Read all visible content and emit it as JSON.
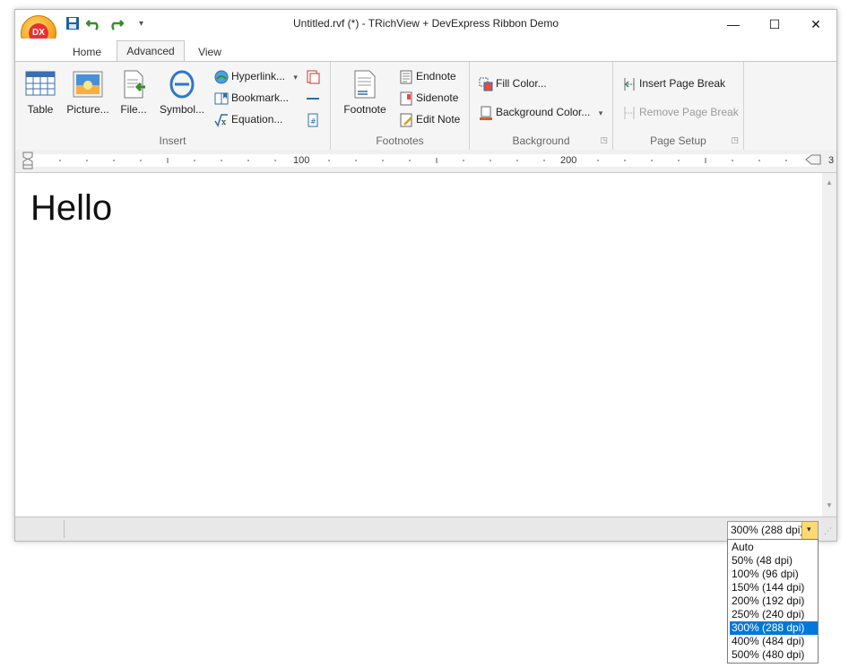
{
  "window": {
    "title": "Untitled.rvf (*) - TRichView + DevExpress Ribbon Demo"
  },
  "app_button": {
    "label": "DX"
  },
  "quick_access": [
    {
      "name": "save-icon"
    },
    {
      "name": "undo-icon"
    },
    {
      "name": "redo-icon"
    },
    {
      "name": "customize-qat-icon"
    }
  ],
  "tabs": [
    {
      "label": "Home"
    },
    {
      "label": "Advanced",
      "active": true
    },
    {
      "label": "View"
    }
  ],
  "ribbon": {
    "insert": {
      "label": "Insert",
      "table": "Table",
      "picture": "Picture...",
      "file": "File...",
      "symbol": "Symbol...",
      "hyperlink": "Hyperlink...",
      "bookmark": "Bookmark...",
      "equation": "Equation..."
    },
    "footnotes": {
      "label": "Footnotes",
      "footnote": "Footnote",
      "endnote": "Endnote",
      "sidenote": "Sidenote",
      "edit_note": "Edit Note"
    },
    "background": {
      "label": "Background",
      "fill_color": "Fill Color...",
      "background_color": "Background Color..."
    },
    "page_setup": {
      "label": "Page Setup",
      "insert_page_break": "Insert Page Break",
      "remove_page_break": "Remove Page Break"
    }
  },
  "ruler": {
    "marks": [
      "100",
      "200",
      "3"
    ]
  },
  "document": {
    "text": "Hello"
  },
  "status": {
    "zoom_value": "300% (288 dpi)",
    "zoom_options": [
      "Auto",
      "50% (48 dpi)",
      "100% (96 dpi)",
      "150% (144 dpi)",
      "200% (192 dpi)",
      "250% (240 dpi)",
      "300% (288 dpi)",
      "400% (484 dpi)",
      "500% (480 dpi)"
    ],
    "zoom_selected_index": 6
  },
  "colors": {
    "accent_yellow": "#ffd971",
    "selection_blue": "#0078d7",
    "background_color_bar": "#e05a1e"
  }
}
